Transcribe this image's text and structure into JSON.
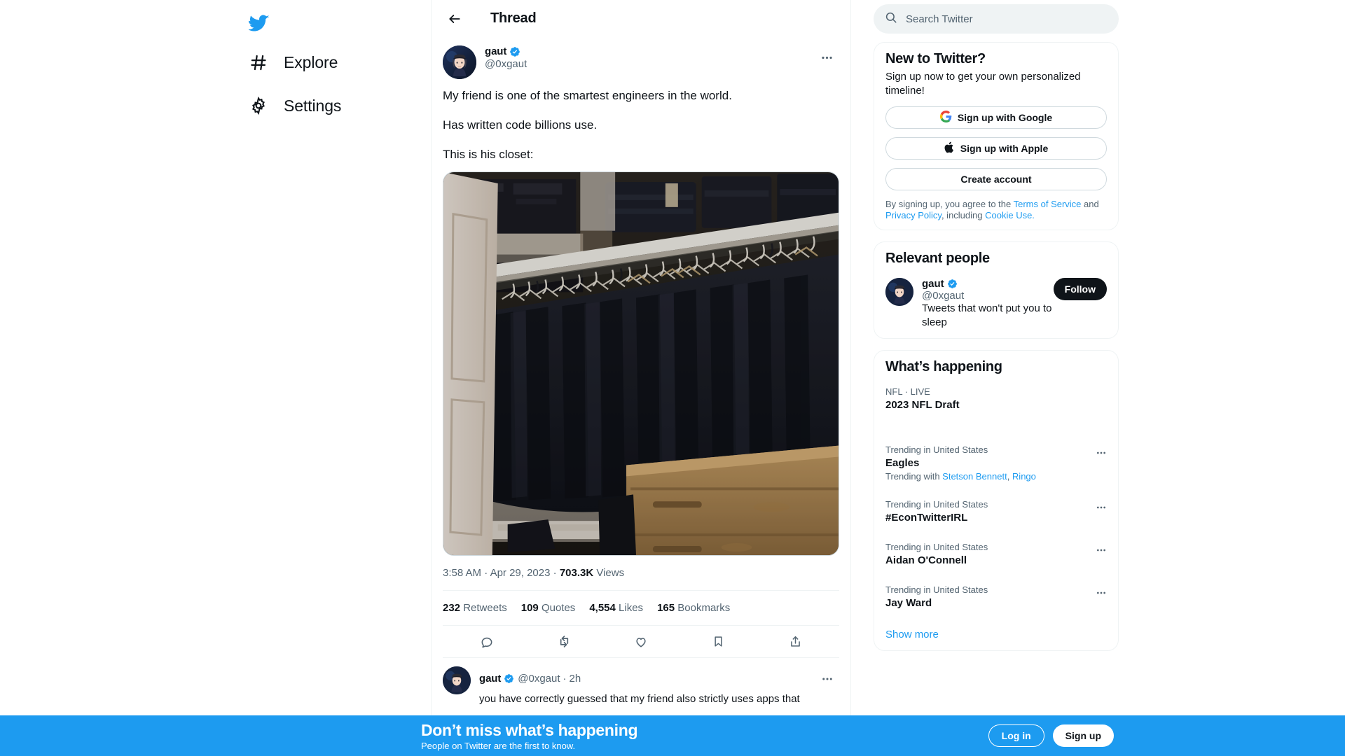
{
  "sidebar": {
    "logo_icon": "twitter-bird-icon",
    "items": [
      {
        "label": "Explore",
        "icon": "hashtag-icon"
      },
      {
        "label": "Settings",
        "icon": "gear-icon"
      }
    ]
  },
  "center": {
    "header": {
      "back_icon": "back-arrow-icon",
      "title": "Thread"
    },
    "tweet": {
      "display_name": "gaut",
      "handle": "@0xgaut",
      "verified": true,
      "more_icon": "ellipsis-icon",
      "paragraphs": [
        "My friend is one of the smartest engineers in the world.",
        "Has written code billions use.",
        "This is his closet:"
      ],
      "media_alt": "closet-photo",
      "timestamp_time": "3:58 AM",
      "timestamp_sep1": " · ",
      "timestamp_date": "Apr 29, 2023",
      "timestamp_sep2": " · ",
      "views_count": "703.3K",
      "views_label": "Views",
      "stats": [
        {
          "count": "232",
          "label": "Retweets"
        },
        {
          "count": "109",
          "label": "Quotes"
        },
        {
          "count": "4,554",
          "label": "Likes"
        },
        {
          "count": "165",
          "label": "Bookmarks"
        }
      ],
      "actions": [
        {
          "name": "reply-icon"
        },
        {
          "name": "retweet-icon"
        },
        {
          "name": "like-icon"
        },
        {
          "name": "bookmark-icon"
        },
        {
          "name": "share-icon"
        }
      ]
    },
    "reply": {
      "display_name": "gaut",
      "handle": "@0xgaut",
      "time_ago": "2h",
      "separator": "·",
      "verified": true,
      "more_icon": "ellipsis-icon",
      "text": "you have correctly guessed that my friend also strictly uses apps that"
    }
  },
  "right": {
    "search": {
      "placeholder": "Search Twitter",
      "value": "",
      "icon": "search-icon"
    },
    "signup_card": {
      "title": "New to Twitter?",
      "subtitle": "Sign up now to get your own personalized timeline!",
      "google_button": "Sign up with Google",
      "apple_button": "Sign up with Apple",
      "create_button": "Create account",
      "legal_pre": "By signing up, you agree to the ",
      "legal_tos": "Terms of Service",
      "legal_and": " and ",
      "legal_privacy": "Privacy Policy",
      "legal_incl": ", including ",
      "legal_cookie": "Cookie Use."
    },
    "relevant_people": {
      "title": "Relevant people",
      "person": {
        "display_name": "gaut",
        "handle": "@0xgaut",
        "verified": true,
        "bio": "Tweets that won't put you to sleep",
        "follow_label": "Follow"
      }
    },
    "whats_happening": {
      "title": "What’s happening",
      "live_item": {
        "category": "NFL · LIVE",
        "name": "2023 NFL Draft"
      },
      "trends": [
        {
          "category": "Trending in United States",
          "name": "Eagles",
          "with_prefix": "Trending with ",
          "with_links": [
            "Stetson Bennett",
            "Ringo"
          ],
          "more_icon": "ellipsis-icon"
        },
        {
          "category": "Trending in United States",
          "name": "#EconTwitterIRL",
          "with_prefix": "",
          "with_links": [],
          "more_icon": "ellipsis-icon"
        },
        {
          "category": "Trending in United States",
          "name": "Aidan O'Connell",
          "with_prefix": "",
          "with_links": [],
          "more_icon": "ellipsis-icon"
        },
        {
          "category": "Trending in United States",
          "name": "Jay Ward",
          "with_prefix": "",
          "with_links": [],
          "more_icon": "ellipsis-icon"
        }
      ],
      "show_more": "Show more"
    }
  },
  "banner": {
    "headline": "Don’t miss what’s happening",
    "subtext": "People on Twitter are the first to know.",
    "login_label": "Log in",
    "signup_label": "Sign up",
    "background_color": "#1d9bf0"
  },
  "colors": {
    "accent": "#1d9bf0",
    "text_primary": "#0f1419",
    "text_secondary": "#536471",
    "border": "#eff3f4",
    "search_bg": "#eff3f4",
    "follow_bg": "#0f1419"
  }
}
